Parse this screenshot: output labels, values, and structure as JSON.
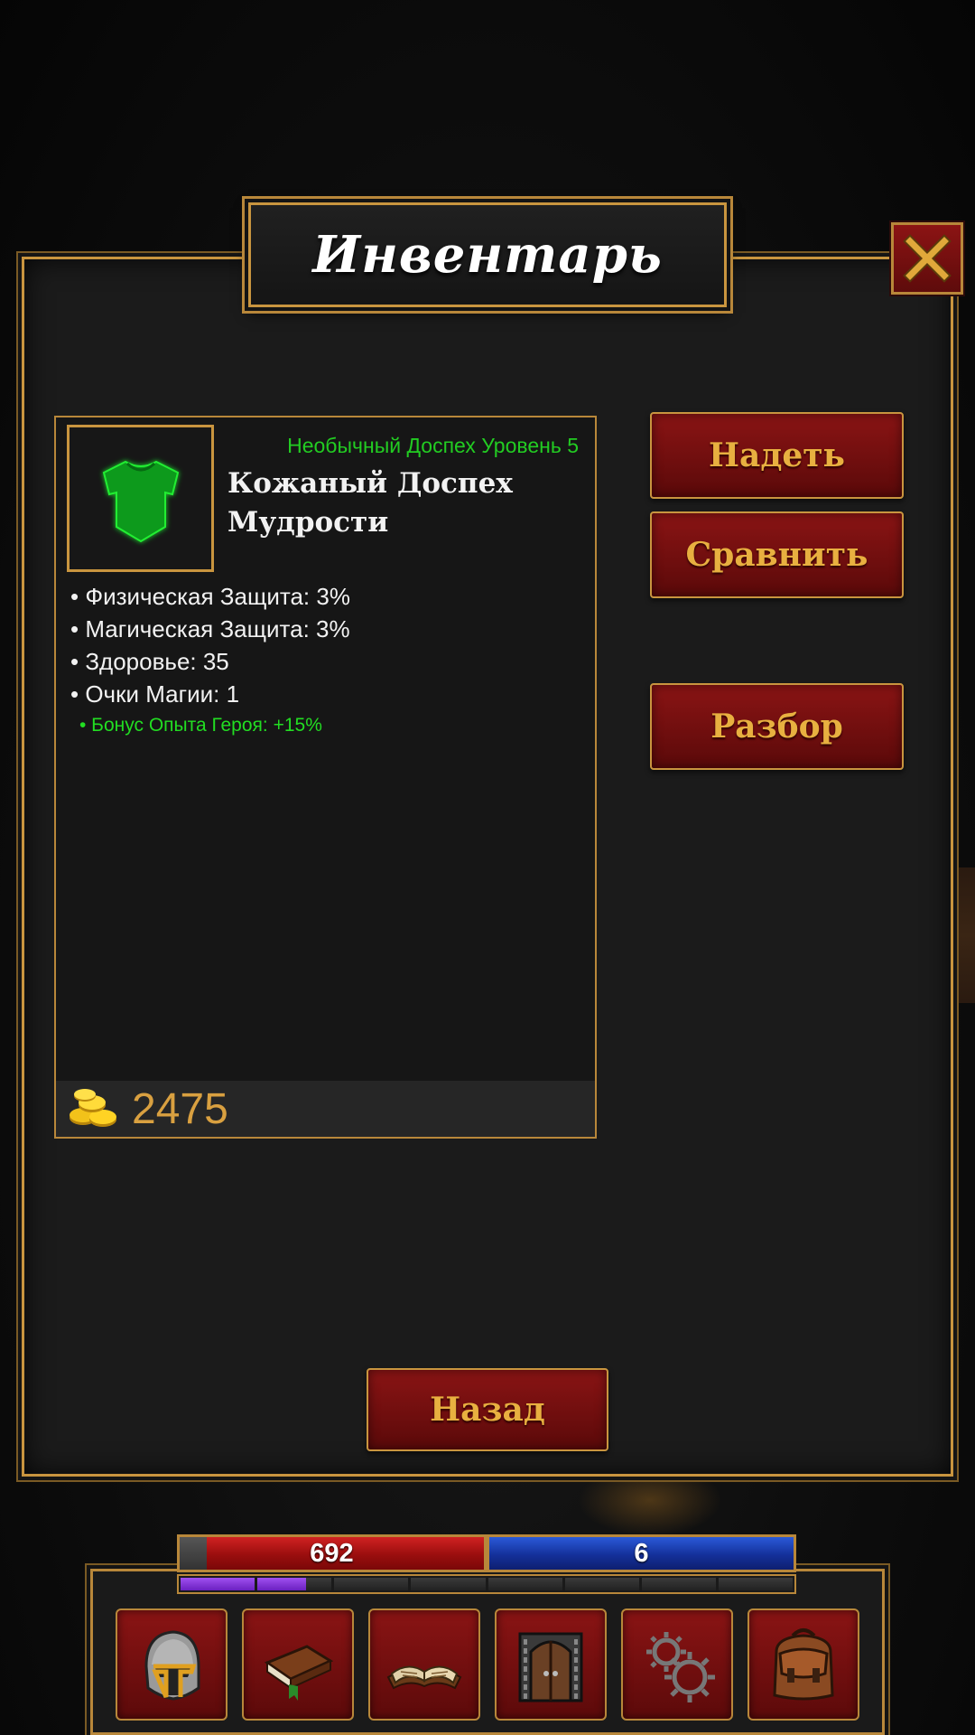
{
  "window": {
    "title": "Инвентарь"
  },
  "item": {
    "rarity_level": "Необычный Доспех Уровень 5",
    "name": "Кожаный Доспех Мудрости",
    "icon": "green-armor-icon",
    "stats": [
      "• Физическая Защита: 3%",
      "• Магическая Защита: 3%",
      "• Здоровье: 35",
      "• Очки Магии: 1"
    ],
    "bonus": "• Бонус Опыта Героя: +15%",
    "price": "2475"
  },
  "actions": {
    "equip": "Надеть",
    "compare": "Сравнить",
    "disassemble": "Разбор",
    "back": "Назад"
  },
  "hud": {
    "hp": "692",
    "mp": "6",
    "xp_segments_total": 8,
    "xp_segments_filled": 1.65
  },
  "menu": {
    "items": [
      {
        "icon": "helmet-icon"
      },
      {
        "icon": "book-icon"
      },
      {
        "icon": "open-book-icon"
      },
      {
        "icon": "door-icon"
      },
      {
        "icon": "gears-icon"
      },
      {
        "icon": "backpack-icon"
      }
    ]
  },
  "colors": {
    "gold_border": "#c9953f",
    "button_red": "#7a1010",
    "button_text": "#e8b040",
    "rarity_green": "#22cc22",
    "gold_text": "#d9a040"
  }
}
